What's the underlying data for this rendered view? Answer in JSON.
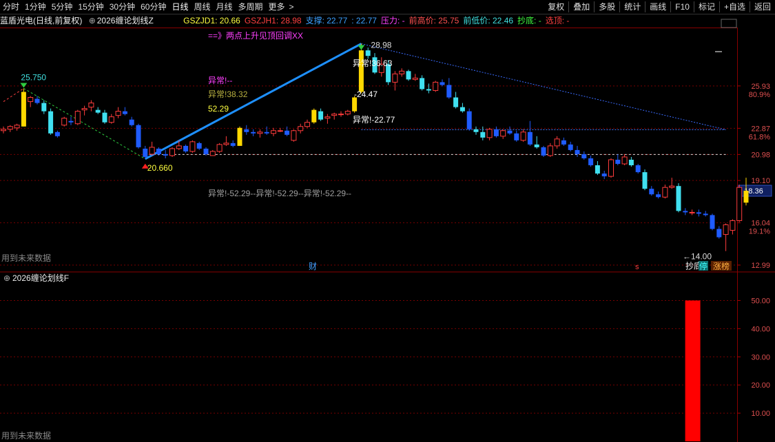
{
  "toolbar": {
    "periods": [
      "分时",
      "1分钟",
      "5分钟",
      "15分钟",
      "30分钟",
      "60分钟",
      "日线",
      "周线",
      "月线",
      "多周期",
      "更多"
    ],
    "active_period": "日线",
    "more_arrow": ">",
    "right_items": [
      "复权",
      "叠加",
      "多股",
      "统计",
      "画线",
      "F10",
      "标记",
      "+自选",
      "返回"
    ]
  },
  "infobar": {
    "stock_name": "蓝盾光电",
    "mode": "(日线,前复权)",
    "indicator_name": "2026缠论划线Z",
    "fields": [
      {
        "label": "GSZJD1:",
        "value": "20.66",
        "color": "#ffff40"
      },
      {
        "label": "GSZJH1:",
        "value": "28.98",
        "color": "#ff4040"
      },
      {
        "label": "支撑:",
        "value": "22.77",
        "color": "#3ca0ff"
      },
      {
        "label": ":",
        "value": "22.77",
        "color": "#3ca0ff"
      },
      {
        "label": "压力:",
        "value": "-",
        "color": "#ff40ff"
      },
      {
        "label": "前高价:",
        "value": "25.75",
        "color": "#ff5050"
      },
      {
        "label": "前低价:",
        "value": "22.46",
        "color": "#40e0e0"
      },
      {
        "label": "抄底:",
        "value": "-",
        "color": "#40ff40"
      },
      {
        "label": "选顶:",
        "value": "-",
        "color": "#ff4040"
      }
    ]
  },
  "main_panel": {
    "y_axis_labels": [
      "25.93",
      "22.87",
      "20.98",
      "19.10",
      "16.04",
      "12.99"
    ],
    "pct_labels": [
      "80.9%",
      "61.8%",
      "19.1%"
    ],
    "current_price": "18.36",
    "footer_note": "用到未来数据",
    "annotations": {
      "pattern_note": "==》两点上升见顶回调XX",
      "high_marker": "25.750",
      "low_marker": "20.660",
      "peak_marker": "28.98",
      "bottom_marker": "14.00",
      "bottom_label": "抄底",
      "abn1": "异常!--",
      "abn2": "异常!38.32",
      "abn2_value": "52.29",
      "abn3": "异常!36.63",
      "abn4": "-24.47",
      "abn5": "异常!-22.77",
      "abn_row": "异常!-52.29--异常!-52.29--异常!-52.29--",
      "cai": "财",
      "s_mark": "s",
      "ting": "停",
      "zhangbang": "涨榜"
    }
  },
  "sub_panel": {
    "indicator_name": "2026缠论划线F",
    "y_axis_labels": [
      "50.00",
      "40.00",
      "30.00",
      "20.00",
      "10.00"
    ],
    "footer_note": "用到未来数据"
  },
  "colors": {
    "up_candle": "#ff3c3c",
    "down_candle": "#1f5cff",
    "down_candle_light": "#40e0f0",
    "special_candle": "#ffd800",
    "trend_line": "#1e90ff",
    "grid": "#7a0000",
    "volume_bar": "#ff0000"
  },
  "chart_data": {
    "type": "candlestick",
    "ylim": [
      12.99,
      30.0
    ],
    "candles": [
      {
        "o": 22.7,
        "h": 23.0,
        "l": 22.5,
        "c": 22.8
      },
      {
        "o": 22.8,
        "h": 23.1,
        "l": 22.6,
        "c": 23.0
      },
      {
        "o": 22.9,
        "h": 23.2,
        "l": 22.7,
        "c": 23.1
      },
      {
        "o": 23.0,
        "h": 25.75,
        "l": 23.0,
        "c": 25.5,
        "s": 1
      },
      {
        "o": 24.8,
        "h": 25.2,
        "l": 24.4,
        "c": 25.1
      },
      {
        "o": 25.0,
        "h": 25.2,
        "l": 24.6,
        "c": 24.7
      },
      {
        "o": 24.7,
        "h": 24.9,
        "l": 23.9,
        "c": 24.1,
        "lt": 1
      },
      {
        "o": 24.1,
        "h": 24.3,
        "l": 22.4,
        "c": 22.5,
        "lt": 1
      },
      {
        "o": 22.6,
        "h": 22.7,
        "l": 22.2,
        "c": 22.3
      },
      {
        "o": 23.1,
        "h": 23.7,
        "l": 23.0,
        "c": 23.6
      },
      {
        "o": 23.4,
        "h": 23.7,
        "l": 23.1,
        "c": 23.3
      },
      {
        "o": 23.2,
        "h": 24.2,
        "l": 23.1,
        "c": 24.1
      },
      {
        "o": 24.2,
        "h": 24.5,
        "l": 23.8,
        "c": 24.3
      },
      {
        "o": 24.4,
        "h": 24.9,
        "l": 24.1,
        "c": 24.7
      },
      {
        "o": 24.2,
        "h": 24.4,
        "l": 23.9,
        "c": 24.0,
        "lt": 1
      },
      {
        "o": 24.0,
        "h": 24.2,
        "l": 23.2,
        "c": 23.3,
        "lt": 1
      },
      {
        "o": 23.3,
        "h": 23.9,
        "l": 23.2,
        "c": 23.7
      },
      {
        "o": 23.8,
        "h": 24.4,
        "l": 23.6,
        "c": 24.1
      },
      {
        "o": 24.1,
        "h": 24.4,
        "l": 23.8,
        "c": 23.9
      },
      {
        "o": 23.5,
        "h": 23.7,
        "l": 23.0,
        "c": 23.1
      },
      {
        "o": 23.1,
        "h": 23.2,
        "l": 21.4,
        "c": 21.5
      },
      {
        "o": 21.4,
        "h": 21.6,
        "l": 20.66,
        "c": 20.8
      },
      {
        "o": 21.0,
        "h": 21.9,
        "l": 20.9,
        "c": 21.5
      },
      {
        "o": 21.4,
        "h": 21.5,
        "l": 20.9,
        "c": 21.0
      },
      {
        "o": 21.0,
        "h": 21.3,
        "l": 20.7,
        "c": 20.9
      },
      {
        "o": 20.9,
        "h": 21.5,
        "l": 20.8,
        "c": 21.4
      },
      {
        "o": 21.4,
        "h": 22.0,
        "l": 21.3,
        "c": 21.6
      },
      {
        "o": 21.6,
        "h": 21.7,
        "l": 21.1,
        "c": 21.2
      },
      {
        "o": 21.2,
        "h": 22.0,
        "l": 21.1,
        "c": 21.9
      },
      {
        "o": 21.8,
        "h": 21.9,
        "l": 21.3,
        "c": 21.4
      },
      {
        "o": 21.4,
        "h": 21.5,
        "l": 20.9,
        "c": 21.0
      },
      {
        "o": 20.9,
        "h": 21.3,
        "l": 20.9,
        "c": 21.2
      },
      {
        "o": 21.2,
        "h": 21.8,
        "l": 21.1,
        "c": 21.7
      },
      {
        "o": 21.7,
        "h": 22.3,
        "l": 21.6,
        "c": 21.8
      },
      {
        "o": 21.8,
        "h": 22.0,
        "l": 21.5,
        "c": 21.6
      },
      {
        "o": 21.6,
        "h": 23.0,
        "l": 21.6,
        "c": 22.9,
        "s": 1
      },
      {
        "o": 22.8,
        "h": 23.1,
        "l": 22.4,
        "c": 22.6
      },
      {
        "o": 22.6,
        "h": 22.8,
        "l": 22.3,
        "c": 22.5
      },
      {
        "o": 22.5,
        "h": 22.8,
        "l": 22.2,
        "c": 22.6
      },
      {
        "o": 22.6,
        "h": 23.0,
        "l": 22.4,
        "c": 22.5
      },
      {
        "o": 22.5,
        "h": 22.9,
        "l": 22.3,
        "c": 22.7
      },
      {
        "o": 22.7,
        "h": 22.9,
        "l": 22.6,
        "c": 22.7
      },
      {
        "o": 22.7,
        "h": 23.0,
        "l": 22.3,
        "c": 22.4
      },
      {
        "o": 22.0,
        "h": 22.8,
        "l": 21.9,
        "c": 22.7
      },
      {
        "o": 22.7,
        "h": 23.2,
        "l": 22.5,
        "c": 23.0
      },
      {
        "o": 23.0,
        "h": 23.5,
        "l": 22.9,
        "c": 23.3
      },
      {
        "o": 23.3,
        "h": 24.3,
        "l": 23.2,
        "c": 24.2,
        "s": 1
      },
      {
        "o": 24.1,
        "h": 24.3,
        "l": 23.4,
        "c": 23.5,
        "lt": 1
      },
      {
        "o": 23.6,
        "h": 23.9,
        "l": 23.2,
        "c": 23.7
      },
      {
        "o": 23.8,
        "h": 24.0,
        "l": 23.5,
        "c": 23.9
      },
      {
        "o": 23.9,
        "h": 24.1,
        "l": 23.7,
        "c": 23.9
      },
      {
        "o": 23.9,
        "h": 24.2,
        "l": 23.8,
        "c": 24.1
      },
      {
        "o": 24.1,
        "h": 25.2,
        "l": 24.0,
        "c": 25.1,
        "s": 1
      },
      {
        "o": 25.5,
        "h": 28.98,
        "l": 25.4,
        "c": 28.5,
        "s": 1
      },
      {
        "o": 28.5,
        "h": 28.7,
        "l": 27.9,
        "c": 28.1,
        "lt": 1
      },
      {
        "o": 28.0,
        "h": 28.3,
        "l": 26.8,
        "c": 26.9,
        "lt": 1
      },
      {
        "o": 26.9,
        "h": 28.0,
        "l": 26.6,
        "c": 27.5
      },
      {
        "o": 27.5,
        "h": 27.8,
        "l": 26.0,
        "c": 26.2,
        "lt": 1
      },
      {
        "o": 26.2,
        "h": 27.0,
        "l": 25.6,
        "c": 26.8
      },
      {
        "o": 26.8,
        "h": 27.2,
        "l": 26.6,
        "c": 27.0
      },
      {
        "o": 27.0,
        "h": 27.1,
        "l": 26.3,
        "c": 26.4,
        "lt": 1
      },
      {
        "o": 26.4,
        "h": 26.8,
        "l": 26.3,
        "c": 26.5
      },
      {
        "o": 26.5,
        "h": 26.7,
        "l": 25.6,
        "c": 25.7,
        "lt": 1
      },
      {
        "o": 25.7,
        "h": 26.1,
        "l": 25.4,
        "c": 25.6,
        "lt": 1
      },
      {
        "o": 25.6,
        "h": 26.3,
        "l": 25.5,
        "c": 26.2
      },
      {
        "o": 26.2,
        "h": 26.4,
        "l": 25.9,
        "c": 26.0
      },
      {
        "o": 26.0,
        "h": 26.5,
        "l": 25.0,
        "c": 25.1
      },
      {
        "o": 25.1,
        "h": 25.5,
        "l": 24.3,
        "c": 24.4,
        "lt": 1
      },
      {
        "o": 24.4,
        "h": 24.7,
        "l": 24.0,
        "c": 24.1,
        "lt": 1
      },
      {
        "o": 24.1,
        "h": 24.3,
        "l": 22.7,
        "c": 22.8
      },
      {
        "o": 22.8,
        "h": 23.0,
        "l": 22.4,
        "c": 22.6,
        "lt": 1
      },
      {
        "o": 22.6,
        "h": 23.0,
        "l": 22.0,
        "c": 22.2,
        "lt": 1
      },
      {
        "o": 22.2,
        "h": 22.9,
        "l": 22.0,
        "c": 22.8
      },
      {
        "o": 22.8,
        "h": 23.0,
        "l": 22.2,
        "c": 22.3
      },
      {
        "o": 22.3,
        "h": 22.8,
        "l": 22.1,
        "c": 22.7
      },
      {
        "o": 22.7,
        "h": 23.0,
        "l": 22.4,
        "c": 22.5
      },
      {
        "o": 22.5,
        "h": 22.7,
        "l": 21.9,
        "c": 22.0
      },
      {
        "o": 22.0,
        "h": 22.8,
        "l": 21.9,
        "c": 22.6
      },
      {
        "o": 22.6,
        "h": 23.4,
        "l": 21.6,
        "c": 21.7
      },
      {
        "o": 21.7,
        "h": 22.3,
        "l": 21.4,
        "c": 21.5,
        "lt": 1
      },
      {
        "o": 21.5,
        "h": 21.6,
        "l": 20.8,
        "c": 20.9
      },
      {
        "o": 20.9,
        "h": 21.8,
        "l": 20.8,
        "c": 21.6
      },
      {
        "o": 21.6,
        "h": 22.3,
        "l": 21.4,
        "c": 22.1
      },
      {
        "o": 22.0,
        "h": 22.2,
        "l": 21.6,
        "c": 21.7
      },
      {
        "o": 21.7,
        "h": 21.9,
        "l": 21.2,
        "c": 21.3
      },
      {
        "o": 21.3,
        "h": 21.6,
        "l": 20.8,
        "c": 21.0
      },
      {
        "o": 21.0,
        "h": 21.2,
        "l": 20.6,
        "c": 20.7
      },
      {
        "o": 20.7,
        "h": 20.9,
        "l": 20.1,
        "c": 20.2
      },
      {
        "o": 20.2,
        "h": 20.5,
        "l": 19.5,
        "c": 19.6,
        "lt": 1
      },
      {
        "o": 19.6,
        "h": 19.8,
        "l": 19.2,
        "c": 19.4
      },
      {
        "o": 19.4,
        "h": 20.7,
        "l": 19.3,
        "c": 20.6
      },
      {
        "o": 20.6,
        "h": 21.0,
        "l": 20.2,
        "c": 20.3
      },
      {
        "o": 20.3,
        "h": 21.0,
        "l": 20.2,
        "c": 20.8
      },
      {
        "o": 20.6,
        "h": 20.8,
        "l": 20.1,
        "c": 20.2,
        "lt": 1
      },
      {
        "o": 20.2,
        "h": 20.3,
        "l": 19.6,
        "c": 19.7
      },
      {
        "o": 19.7,
        "h": 19.9,
        "l": 18.4,
        "c": 18.5,
        "lt": 1
      },
      {
        "o": 18.5,
        "h": 18.7,
        "l": 18.0,
        "c": 18.1
      },
      {
        "o": 18.1,
        "h": 18.3,
        "l": 17.8,
        "c": 17.9
      },
      {
        "o": 17.9,
        "h": 18.8,
        "l": 17.8,
        "c": 18.6
      },
      {
        "o": 18.6,
        "h": 19.3,
        "l": 18.5,
        "c": 18.7
      },
      {
        "o": 18.7,
        "h": 18.9,
        "l": 16.8,
        "c": 16.9,
        "lt": 1
      },
      {
        "o": 16.9,
        "h": 17.1,
        "l": 16.6,
        "c": 16.8
      },
      {
        "o": 16.8,
        "h": 17.0,
        "l": 16.6,
        "c": 16.8
      },
      {
        "o": 16.8,
        "h": 17.0,
        "l": 16.5,
        "c": 16.7
      },
      {
        "o": 16.7,
        "h": 16.9,
        "l": 16.5,
        "c": 16.6
      },
      {
        "o": 16.6,
        "h": 16.7,
        "l": 15.5,
        "c": 15.6
      },
      {
        "o": 15.6,
        "h": 15.8,
        "l": 14.9,
        "c": 15.0
      },
      {
        "o": 15.2,
        "h": 16.0,
        "l": 14.0,
        "c": 15.9
      },
      {
        "o": 15.5,
        "h": 16.3,
        "l": 15.2,
        "c": 16.2
      },
      {
        "o": 16.2,
        "h": 18.8,
        "l": 16.1,
        "c": 18.6
      },
      {
        "o": 17.5,
        "h": 19.3,
        "l": 17.3,
        "c": 18.36,
        "s": 1
      }
    ],
    "overlays": [
      {
        "from": [
          3,
          25.75
        ],
        "to": [
          21,
          20.66
        ],
        "style": "dash-green"
      },
      {
        "from": [
          21,
          20.66
        ],
        "to": [
          53,
          28.98
        ],
        "style": "solid-blue"
      },
      {
        "from": [
          53,
          28.98
        ],
        "to": [
          107,
          22.77
        ],
        "style": "dot-blue"
      },
      {
        "from": [
          0,
          24.8
        ],
        "to": [
          3,
          25.75
        ],
        "style": "dash-red"
      }
    ],
    "hlines": [
      {
        "y": 20.98,
        "from": 21,
        "to": 107,
        "style": "dot-white"
      },
      {
        "y": 22.77,
        "from": 53,
        "to": 107,
        "style": "dot-blue"
      }
    ],
    "sub_ylim": [
      0,
      55
    ],
    "sub_bars": [
      {
        "index": 102,
        "value": 50.0
      }
    ]
  }
}
